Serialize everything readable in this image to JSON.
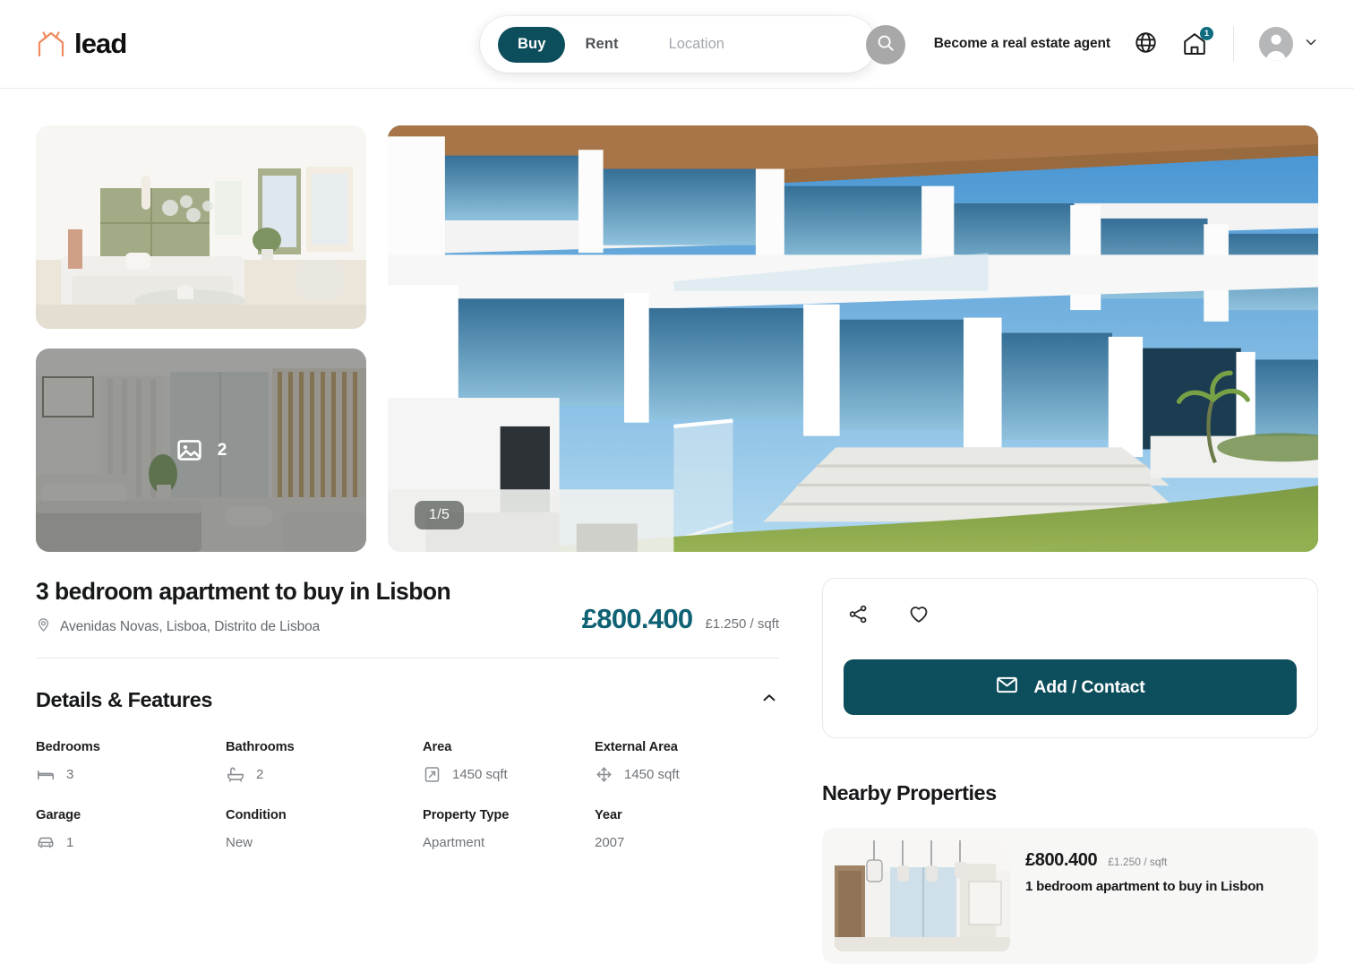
{
  "header": {
    "brand_name": "lead",
    "brand_icon": "house-outline-icon",
    "agent_link": "Become a real estate agent",
    "globe_icon": "globe-icon",
    "saved_icon": "house-icon",
    "saved_badge": "1",
    "avatar_icon": "avatar-icon",
    "chevron_icon": "chevron-down-icon"
  },
  "search": {
    "buy_label": "Buy",
    "rent_label": "Rent",
    "location_value": "",
    "location_placeholder": "Location",
    "search_icon": "search-icon",
    "active_tab": "Buy"
  },
  "gallery": {
    "counter": "1/5",
    "more_count": "2",
    "more_icon": "image-icon",
    "thumb1_alt": "living-room",
    "thumb2_alt": "bedroom",
    "hero_alt": "villa-exterior"
  },
  "listing": {
    "title": "3 bedroom apartment to buy in Lisbon",
    "address": "Avenidas Novas, Lisboa, Distrito de Lisboa",
    "pin_icon": "location-pin-icon",
    "price": "£800.400",
    "price_unit": "£1.250 / sqft"
  },
  "details": {
    "section_title": "Details & Features",
    "collapse_icon": "chevron-up-icon",
    "items": [
      {
        "label": "Bedrooms",
        "value": "3",
        "icon": "bed-icon"
      },
      {
        "label": "Bathrooms",
        "value": "2",
        "icon": "bathtub-icon"
      },
      {
        "label": "Area",
        "value": "1450 sqft",
        "icon": "area-icon"
      },
      {
        "label": "External Area",
        "value": "1450 sqft",
        "icon": "expand-icon"
      },
      {
        "label": "Garage",
        "value": "1",
        "icon": "car-icon"
      },
      {
        "label": "Condition",
        "value": "New",
        "icon": ""
      },
      {
        "label": "Property Type",
        "value": "Apartment",
        "icon": ""
      },
      {
        "label": "Year",
        "value": "2007",
        "icon": ""
      }
    ]
  },
  "actions": {
    "share_icon": "share-icon",
    "favorite_icon": "heart-icon",
    "contact_label": "Add / Contact",
    "contact_icon": "envelope-icon"
  },
  "nearby": {
    "title": "Nearby Properties",
    "cards": [
      {
        "price": "£800.400",
        "price_unit": "£1.250 / sqft",
        "name": "1 bedroom apartment to buy in Lisbon",
        "thumb_alt": "interior-pendant-lights"
      }
    ]
  },
  "colors": {
    "brand_orange": "#f08a5d",
    "accent_teal": "#0d4e5c",
    "price_teal": "#0f6174",
    "badge_teal": "#0f6c80"
  }
}
